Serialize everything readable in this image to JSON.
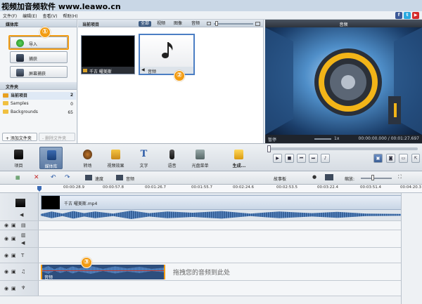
{
  "window": {
    "title": "视频加音频软件 www.leawo.cn"
  },
  "menu": [
    "文件(F)",
    "编辑(E)",
    "查看(V)",
    "帮助(H)"
  ],
  "social": [
    {
      "name": "facebook",
      "glyph": "f",
      "color": "#3b5998"
    },
    {
      "name": "twitter",
      "glyph": "t",
      "color": "#2aa9e0"
    },
    {
      "name": "youtube",
      "glyph": "▶",
      "color": "#d52b2b"
    }
  ],
  "library": {
    "title": "媒体库",
    "import_label": "导入",
    "capture_label": "捕获",
    "screen_capture_label": "屏幕捕获"
  },
  "folders": {
    "title": "文件夹",
    "items": [
      {
        "name": "当前项目",
        "count": "2"
      },
      {
        "name": "Samples",
        "count": "0"
      },
      {
        "name": "Backgrounds",
        "count": "65"
      }
    ],
    "add_label": "+ 添加文件夹",
    "delete_label": "- 删除文件夹"
  },
  "media": {
    "title": "当前项目",
    "filters": [
      "全部",
      "视频",
      "图像",
      "音频"
    ],
    "active_filter": "全部",
    "items": [
      {
        "label": "千古 曜美斯",
        "kind": "video"
      },
      {
        "label": "音频",
        "kind": "audio"
      }
    ]
  },
  "preview": {
    "title": "音频",
    "status": "暂停",
    "speed": "1x",
    "time": "00:00:00.000 / 00:01:27.697"
  },
  "toolbar": {
    "items": [
      "项目",
      "媒体库",
      "转场",
      "视频效果",
      "文字",
      "语音",
      "光盘菜单",
      "生成..."
    ],
    "active": "媒体库"
  },
  "timeline": {
    "speed_label": "速度",
    "audio_label": "音频",
    "storyboard_label": "故事板",
    "zoom_label": "缩放:",
    "ruler": [
      "00:00:28.9",
      "00:00:57.8",
      "00:01:26.7",
      "00:01:55.7",
      "00:02:24.6",
      "00:02:53.5",
      "00:03:22.4",
      "00:03:51.4",
      "00:04:20.3"
    ],
    "video_clip_label": "千古 曜美斯.mp4",
    "audio_clip_label": "音频",
    "drop_hint": "拖拽您的音频到此处"
  },
  "callouts": [
    "①",
    "②",
    "③"
  ],
  "colors": {
    "accent": "#f39c12",
    "waveform": "#3e6aa2",
    "title_bar": "#c9d7e6"
  }
}
